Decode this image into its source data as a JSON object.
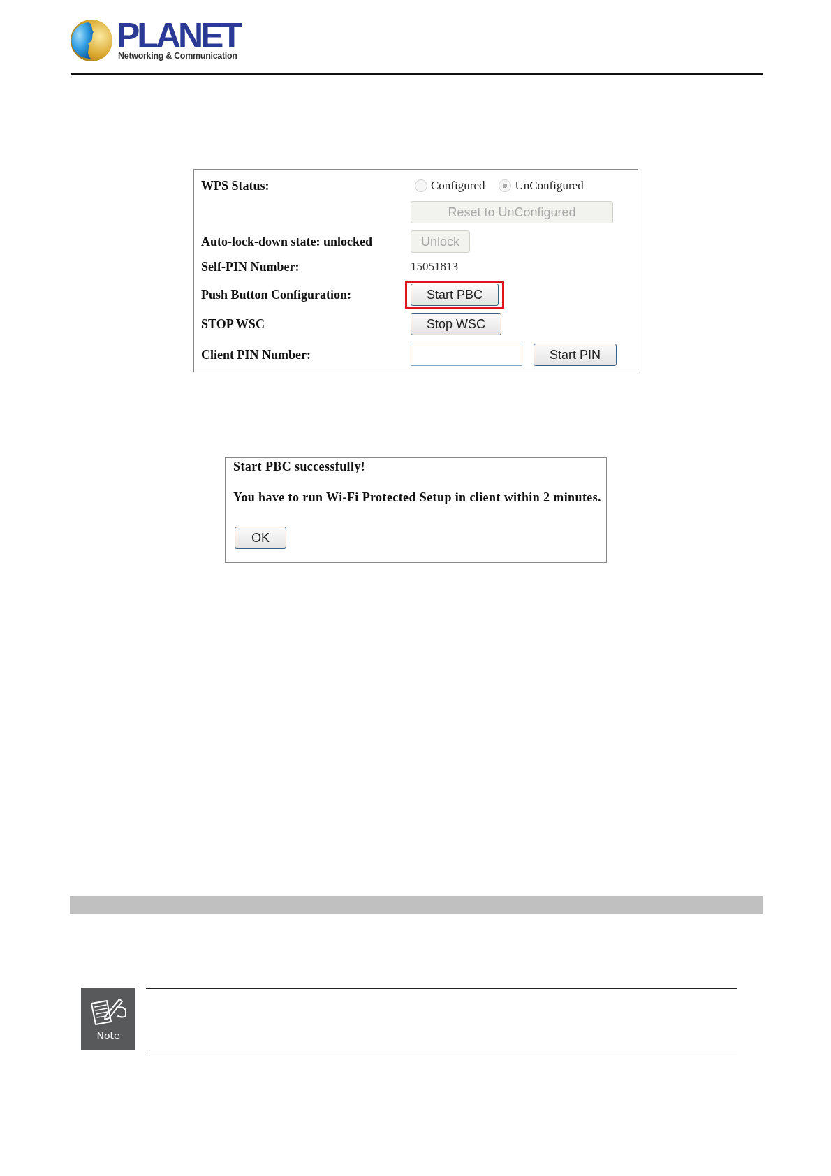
{
  "header": {
    "brand": "PLANET",
    "tagline": "Networking & Communication"
  },
  "wps_panel": {
    "rows": [
      {
        "kind": "radio",
        "label": "WPS Status:",
        "options": [
          {
            "label": "Configured",
            "selected": false,
            "disabled": true
          },
          {
            "label": "UnConfigured",
            "selected": true,
            "disabled": true
          }
        ],
        "buttons": [
          {
            "label": "Reset to UnConfigured",
            "disabled": true,
            "highlighted": false
          }
        ]
      },
      {
        "kind": "button",
        "label": "Auto-lock-down state: unlocked",
        "buttons": [
          {
            "label": "Unlock",
            "disabled": true,
            "highlighted": false
          }
        ]
      },
      {
        "kind": "text",
        "label": "Self-PIN Number:",
        "value": "15051813"
      },
      {
        "kind": "button",
        "label": "Push Button Configuration:",
        "buttons": [
          {
            "label": "Start PBC",
            "disabled": false,
            "highlighted": true
          }
        ]
      },
      {
        "kind": "button",
        "label": "STOP WSC",
        "buttons": [
          {
            "label": "Stop WSC",
            "disabled": false,
            "highlighted": false
          }
        ]
      },
      {
        "kind": "input",
        "label": "Client PIN Number:",
        "buttons": [
          {
            "label": "Start PIN",
            "disabled": false,
            "highlighted": false
          }
        ]
      }
    ]
  },
  "dialog": {
    "title": "Start PBC successfully!",
    "message": "You have to run Wi-Fi Protected Setup in client within 2 minutes.",
    "button": {
      "label": "OK"
    }
  },
  "note": {
    "badge_label": "Note"
  }
}
